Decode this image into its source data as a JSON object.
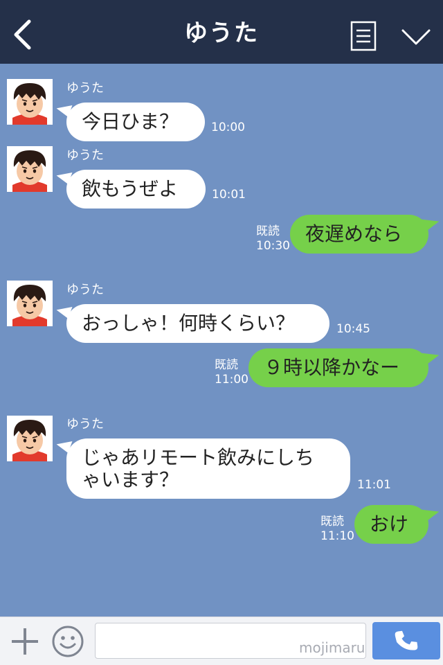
{
  "header": {
    "title": "ゆうた",
    "back_icon": "chevron-left-icon",
    "menu_icon": "list-menu-icon",
    "collapse_icon": "chevron-down-icon"
  },
  "messages": [
    {
      "direction": "in",
      "sender": "ゆうた",
      "text": "今日ひま？",
      "time": "10:00"
    },
    {
      "direction": "in",
      "sender": "ゆうた",
      "text": "飲もうぜよ",
      "time": "10:01"
    },
    {
      "direction": "out",
      "read": "既読",
      "text": "夜遅めなら",
      "time": "10:30"
    },
    {
      "direction": "in",
      "sender": "ゆうた",
      "text": "おっしゃ！何時くらい？",
      "time": "10:45"
    },
    {
      "direction": "out",
      "read": "既読",
      "text": "９時以降かなー",
      "time": "11:00"
    },
    {
      "direction": "in",
      "sender": "ゆうた",
      "text_line1": "じゃあリモート飲みにしち",
      "text_line2": "ゃいます？",
      "time": "11:01"
    },
    {
      "direction": "out",
      "read": "既読",
      "text": "おけ",
      "time": "11:10"
    }
  ],
  "input_bar": {
    "plus_icon": "plus-icon",
    "emoji_icon": "smiley-icon",
    "input_value": "",
    "watermark": "mojimaru",
    "call_icon": "phone-icon"
  },
  "colors": {
    "header_bg": "#243049",
    "chat_bg": "#7192c3",
    "incoming_bubble": "#ffffff",
    "outgoing_bubble": "#76d04a",
    "call_button": "#5a8fe0"
  }
}
